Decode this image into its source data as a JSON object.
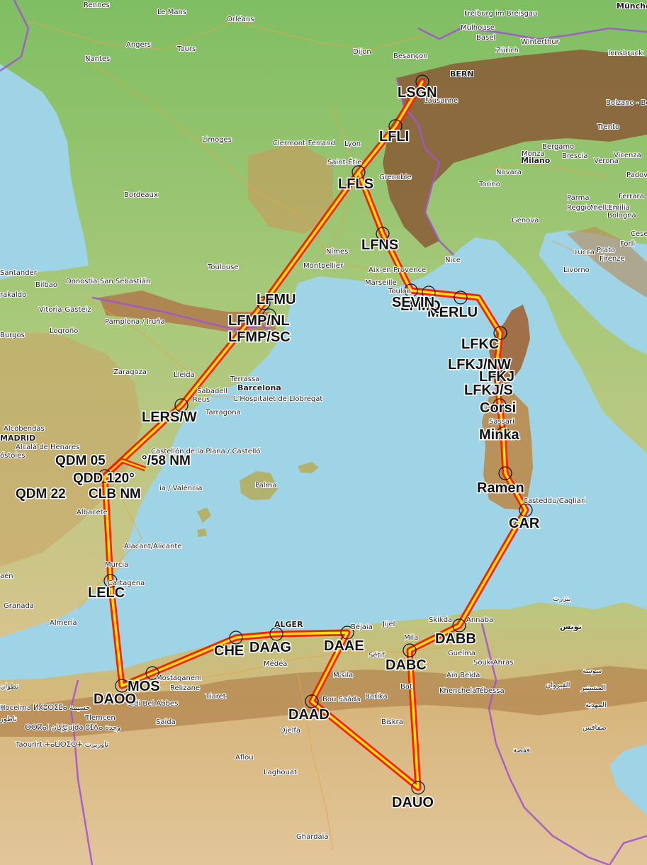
{
  "waypoints": [
    {
      "id": "LSGN",
      "label": "LSGN"
    },
    {
      "id": "LFLI",
      "label": "LFLI"
    },
    {
      "id": "LFLS",
      "label": "LFLS"
    },
    {
      "id": "LFNS",
      "label": "LFNS"
    },
    {
      "id": "LFMU",
      "label": "LFMU"
    },
    {
      "id": "LFMP_NL",
      "label": "LFMP/NL"
    },
    {
      "id": "LFMP_SC",
      "label": "LFMP/SC"
    },
    {
      "id": "LERS_W",
      "label": "LERS/W"
    },
    {
      "id": "LELC",
      "label": "LELC"
    },
    {
      "id": "DAOO",
      "label": "DAOO"
    },
    {
      "id": "MOS",
      "label": "MOS"
    },
    {
      "id": "CHE",
      "label": "CHE"
    },
    {
      "id": "DAAG",
      "label": "DAAG"
    },
    {
      "id": "DAAE",
      "label": "DAAE"
    },
    {
      "id": "DAAD",
      "label": "DAAD"
    },
    {
      "id": "DAUO",
      "label": "DAUO"
    },
    {
      "id": "DABC",
      "label": "DABC"
    },
    {
      "id": "DABB",
      "label": "DABB"
    },
    {
      "id": "CAR",
      "label": "CAR"
    },
    {
      "id": "Ramen",
      "label": "Ramen"
    },
    {
      "id": "Minka",
      "label": "Minka"
    },
    {
      "id": "Corsi",
      "label": "Corsi"
    },
    {
      "id": "LFKJ_S",
      "label": "LFKJ/S"
    },
    {
      "id": "LFKJ",
      "label": "LFKJ"
    },
    {
      "id": "LFKJ_NW",
      "label": "LFKJ/NW"
    },
    {
      "id": "LFKC",
      "label": "LFKC"
    },
    {
      "id": "MERLU",
      "label": "MERLU"
    },
    {
      "id": "LFMQ",
      "label": "LFMQ"
    },
    {
      "id": "SEVIN",
      "label": "SEVIN"
    }
  ],
  "bearing_labels": {
    "qdm_05": "QDM 05",
    "nm_58": "°/58 NM",
    "qdm_22": "QDM 22",
    "nm_clb": "CLB  NM",
    "qdd_120": "QDD 120°"
  },
  "cities": [
    {
      "id": "rennes",
      "name": "Rennes"
    },
    {
      "id": "le-mans",
      "name": "Le Mans"
    },
    {
      "id": "orleans",
      "name": "Orléans"
    },
    {
      "id": "freiburg",
      "name": "Freiburg im Breisgau"
    },
    {
      "id": "munchen",
      "name": "Münche"
    },
    {
      "id": "angers",
      "name": "Angers"
    },
    {
      "id": "tours",
      "name": "Tours"
    },
    {
      "id": "dijon",
      "name": "Dijon"
    },
    {
      "id": "mulhouse",
      "name": "Mulhouse"
    },
    {
      "id": "basel",
      "name": "Basel"
    },
    {
      "id": "winterthur",
      "name": "Winterthur"
    },
    {
      "id": "zurich",
      "name": "Zürich"
    },
    {
      "id": "innsbruck",
      "name": "Innsbruck"
    },
    {
      "id": "nantes",
      "name": "Nantes"
    },
    {
      "id": "besancon",
      "name": "Besançon"
    },
    {
      "id": "bern",
      "name": "BERN"
    },
    {
      "id": "lausanne",
      "name": "Lausanne"
    },
    {
      "id": "bolzano",
      "name": "Bolzano - Bo"
    },
    {
      "id": "limoges",
      "name": "Limoges"
    },
    {
      "id": "clermont",
      "name": "Clermont-Ferrand"
    },
    {
      "id": "lyon",
      "name": "Lyon"
    },
    {
      "id": "bergamo",
      "name": "Bergamo"
    },
    {
      "id": "trento",
      "name": "Trento"
    },
    {
      "id": "monza",
      "name": "Monza"
    },
    {
      "id": "brescia",
      "name": "Brescia"
    },
    {
      "id": "milano",
      "name": "Milano"
    },
    {
      "id": "verona",
      "name": "Verona"
    },
    {
      "id": "vicenza",
      "name": "Vicenza"
    },
    {
      "id": "saint-etienne",
      "name": "Saint-Étie"
    },
    {
      "id": "grenoble",
      "name": "Grenoble"
    },
    {
      "id": "novara",
      "name": "Novara"
    },
    {
      "id": "padova",
      "name": "Padov"
    },
    {
      "id": "bordeaux",
      "name": "Bordeaux"
    },
    {
      "id": "torino",
      "name": "Torino"
    },
    {
      "id": "parma",
      "name": "Parma"
    },
    {
      "id": "modena",
      "name": "Modena"
    },
    {
      "id": "ferrara",
      "name": "Ferrara"
    },
    {
      "id": "genova",
      "name": "Genova"
    },
    {
      "id": "bologna",
      "name": "Bologna"
    },
    {
      "id": "reggio",
      "name": "Reggio nell'Emilia"
    },
    {
      "id": "forli",
      "name": "Forlì"
    },
    {
      "id": "toulouse",
      "name": "Toulouse"
    },
    {
      "id": "nimes",
      "name": "Nîmes"
    },
    {
      "id": "montpellier",
      "name": "Montpellier"
    },
    {
      "id": "nice",
      "name": "Nice"
    },
    {
      "id": "lucca",
      "name": "Lucca"
    },
    {
      "id": "prato",
      "name": "Prato"
    },
    {
      "id": "firenze",
      "name": "Firenze"
    },
    {
      "id": "cesena",
      "name": "Cesen"
    },
    {
      "id": "santander",
      "name": "Santander"
    },
    {
      "id": "bilbao",
      "name": "Bilbao"
    },
    {
      "id": "donostia",
      "name": "Donostia-San Sebastián"
    },
    {
      "id": "aix",
      "name": "Aix-en-Provence"
    },
    {
      "id": "livorno",
      "name": "Livorno"
    },
    {
      "id": "marseille",
      "name": "Marseille"
    },
    {
      "id": "toulon",
      "name": "Toulon"
    },
    {
      "id": "barakaldo",
      "name": "rakaldo"
    },
    {
      "id": "vitoria",
      "name": "Vitoria-Gasteiz"
    },
    {
      "id": "pamplona",
      "name": "Pamplona / Iruña"
    },
    {
      "id": "burgos",
      "name": "Burgos"
    },
    {
      "id": "logrono",
      "name": "Logroño"
    },
    {
      "id": "zaragoza",
      "name": "Zaragoza"
    },
    {
      "id": "lleida",
      "name": "Lleida"
    },
    {
      "id": "terrassa",
      "name": "Terrassa"
    },
    {
      "id": "sabadell",
      "name": "Sabadell"
    },
    {
      "id": "barcelona",
      "name": "Barcelona"
    },
    {
      "id": "reus",
      "name": "Reus"
    },
    {
      "id": "hospitalet",
      "name": "L'Hospitalet de Llobregat"
    },
    {
      "id": "tarragona",
      "name": "Tarragona"
    },
    {
      "id": "alcobendas",
      "name": "Alcobendas"
    },
    {
      "id": "madrid",
      "name": "MADRID"
    },
    {
      "id": "alcala",
      "name": "Alcalá de Henares"
    },
    {
      "id": "mostoles",
      "name": "óstoles"
    },
    {
      "id": "castellon",
      "name": "Castellón de la Plana / Castelló"
    },
    {
      "id": "valencia",
      "name": "ia / València"
    },
    {
      "id": "palma",
      "name": "Palma"
    },
    {
      "id": "albacete",
      "name": "Albacete"
    },
    {
      "id": "alacant",
      "name": "Alacant/Alicante"
    },
    {
      "id": "murcia",
      "name": "Murcia"
    },
    {
      "id": "cartagena",
      "name": "Cartagena"
    },
    {
      "id": "jaen",
      "name": "aén"
    },
    {
      "id": "granada",
      "name": "Granada"
    },
    {
      "id": "almeria",
      "name": "Almería"
    },
    {
      "id": "cagliari",
      "name": "Casteddu/Cagliari"
    },
    {
      "id": "sassari",
      "name": "Sassari"
    },
    {
      "id": "bizerte",
      "name": "بنزرت"
    },
    {
      "id": "skikda",
      "name": "Skikda"
    },
    {
      "id": "annaba",
      "name": "Annaba"
    },
    {
      "id": "tunis",
      "name": "تونس"
    },
    {
      "id": "jijel",
      "name": "Jijel"
    },
    {
      "id": "alger",
      "name": "ALGER"
    },
    {
      "id": "bejaia",
      "name": "Béjaïa"
    },
    {
      "id": "setif",
      "name": "Sétif"
    },
    {
      "id": "mila",
      "name": "Mila"
    },
    {
      "id": "guelma",
      "name": "Guelma"
    },
    {
      "id": "souk-ahras",
      "name": "Souk Ahras"
    },
    {
      "id": "medea",
      "name": "Médéa"
    },
    {
      "id": "msila",
      "name": "M'sila"
    },
    {
      "id": "ain-beida",
      "name": "Aïn Beïda"
    },
    {
      "id": "sousse",
      "name": "سوسة"
    },
    {
      "id": "mostaganem",
      "name": "Mostaganem"
    },
    {
      "id": "relizane",
      "name": "Relizane"
    },
    {
      "id": "tiaret",
      "name": "Tiaret"
    },
    {
      "id": "barika",
      "name": "Barika"
    },
    {
      "id": "batna",
      "name": "Bat"
    },
    {
      "id": "khenchela",
      "name": "Khenchela"
    },
    {
      "id": "tebessa",
      "name": "Tébessa"
    },
    {
      "id": "monastir",
      "name": "المنستير"
    },
    {
      "id": "kairouan",
      "name": "القيروان"
    },
    {
      "id": "mahdia",
      "name": "المهدية"
    },
    {
      "id": "bou-saada",
      "name": "Bou Saâda"
    },
    {
      "id": "sidi-bel-abbes",
      "name": "Sidi Bel Abbes"
    },
    {
      "id": "hoceima",
      "name": "Hoceima ⵍⵃⵓⵙⵉⵎⴰ حسيمة"
    },
    {
      "id": "tetouan",
      "name": "تطوان"
    },
    {
      "id": "tlemcen",
      "name": "Tlemcen"
    },
    {
      "id": "saida",
      "name": "Saïda"
    },
    {
      "id": "biskra",
      "name": "Biskra"
    },
    {
      "id": "sfax",
      "name": "صفاقس"
    },
    {
      "id": "oujda",
      "name": "Oujda ⵓⵊⴷⴰ وجدة"
    },
    {
      "id": "berkane",
      "name": "ⴱⵔⴽⴰⵏ بركان"
    },
    {
      "id": "nador",
      "name": "ناظور"
    },
    {
      "id": "taourirt",
      "name": "Taourirt ⵜⴰⵡⵔⵉⵔⵜ تاوريرت"
    },
    {
      "id": "djelfa",
      "name": "Djelfa"
    },
    {
      "id": "gafsa",
      "name": "قفصة"
    },
    {
      "id": "aflou",
      "name": "Aflou"
    },
    {
      "id": "laghouat",
      "name": "Laghouat"
    },
    {
      "id": "ghardaia",
      "name": "Ghardaïa"
    }
  ]
}
